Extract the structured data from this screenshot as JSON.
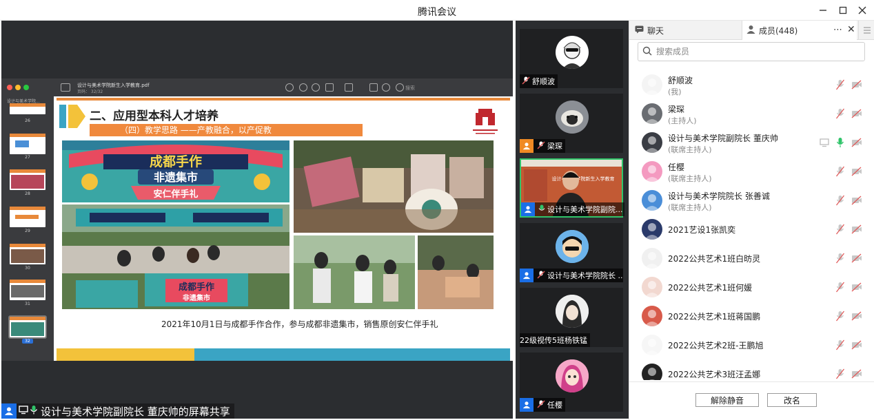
{
  "window": {
    "title": "腾讯会议"
  },
  "share": {
    "label": "设计与美术学院副院长  董庆帅的屏幕共享",
    "pdf_filename": "设计与美术学院新生入学教育.pdf",
    "pdf_pages": "页码：  32/32",
    "search_placeholder": "搜索",
    "sidebar_title": "设计与美术学院...",
    "thumb_numbers": [
      "26",
      "27",
      "28",
      "29",
      "30",
      "31",
      "32"
    ],
    "slide": {
      "heading": "二、应用型本科人才培养",
      "subheading": "（四）教学思路 ——产教融合，以产促教",
      "caption": "2021年10月1日与成都手作合作，参与成都非遗集市，销售原创安仁伴手礼",
      "banner_lines": [
        "成都手作",
        "非遗集市",
        "安仁伴手礼"
      ],
      "table_sign": "成都手作",
      "table_sign2": "非遗集市"
    }
  },
  "video_tiles": [
    {
      "name": "舒顺波",
      "muted": true,
      "host": false
    },
    {
      "name": "梁琛",
      "muted": true,
      "host": true
    },
    {
      "name": "设计与美术学院副院...",
      "muted": false,
      "host": true,
      "active": true
    },
    {
      "name": "设计与美术学院院长 ...",
      "muted": true,
      "host": true
    },
    {
      "name": "22级视传5班杨铁锰",
      "muted": false,
      "host": false
    },
    {
      "name": "任樱",
      "muted": true,
      "host": true
    }
  ],
  "panel": {
    "tab_chat": "聊天",
    "tab_members": "成员(448)",
    "search_placeholder": "搜索成员",
    "members": [
      {
        "name": "舒顺波",
        "role": "(我)",
        "mic": "muted"
      },
      {
        "name": "梁琛",
        "role": "(主持人)",
        "mic": "muted"
      },
      {
        "name": "设计与美术学院副院长  董庆帅",
        "role": "(联席主持人)",
        "mic": "on",
        "screen": true
      },
      {
        "name": "任樱",
        "role": "(联席主持人)",
        "mic": "muted"
      },
      {
        "name": "设计与美术学院院长 张善诚",
        "role": "(联席主持人)",
        "mic": "muted"
      },
      {
        "name": "2021艺设1张凯奕",
        "role": "",
        "mic": "muted"
      },
      {
        "name": "2022公共艺术1班白昉灵",
        "role": "",
        "mic": "muted"
      },
      {
        "name": "2022公共艺术1班何媛",
        "role": "",
        "mic": "muted"
      },
      {
        "name": "2022公共艺术1班蒋国鹏",
        "role": "",
        "mic": "muted"
      },
      {
        "name": "2022公共艺术2班-王鹏旭",
        "role": "",
        "mic": "muted"
      },
      {
        "name": "2022公共艺术3班汪孟娜",
        "role": "",
        "mic": "muted"
      }
    ],
    "btn_unmute_all": "解除静音",
    "btn_rename": "改名"
  },
  "colors": {
    "accent": "#1a6ee6",
    "slide_orange": "#f0893d",
    "green": "#30c46a",
    "muted_red": "#e05a5a"
  }
}
